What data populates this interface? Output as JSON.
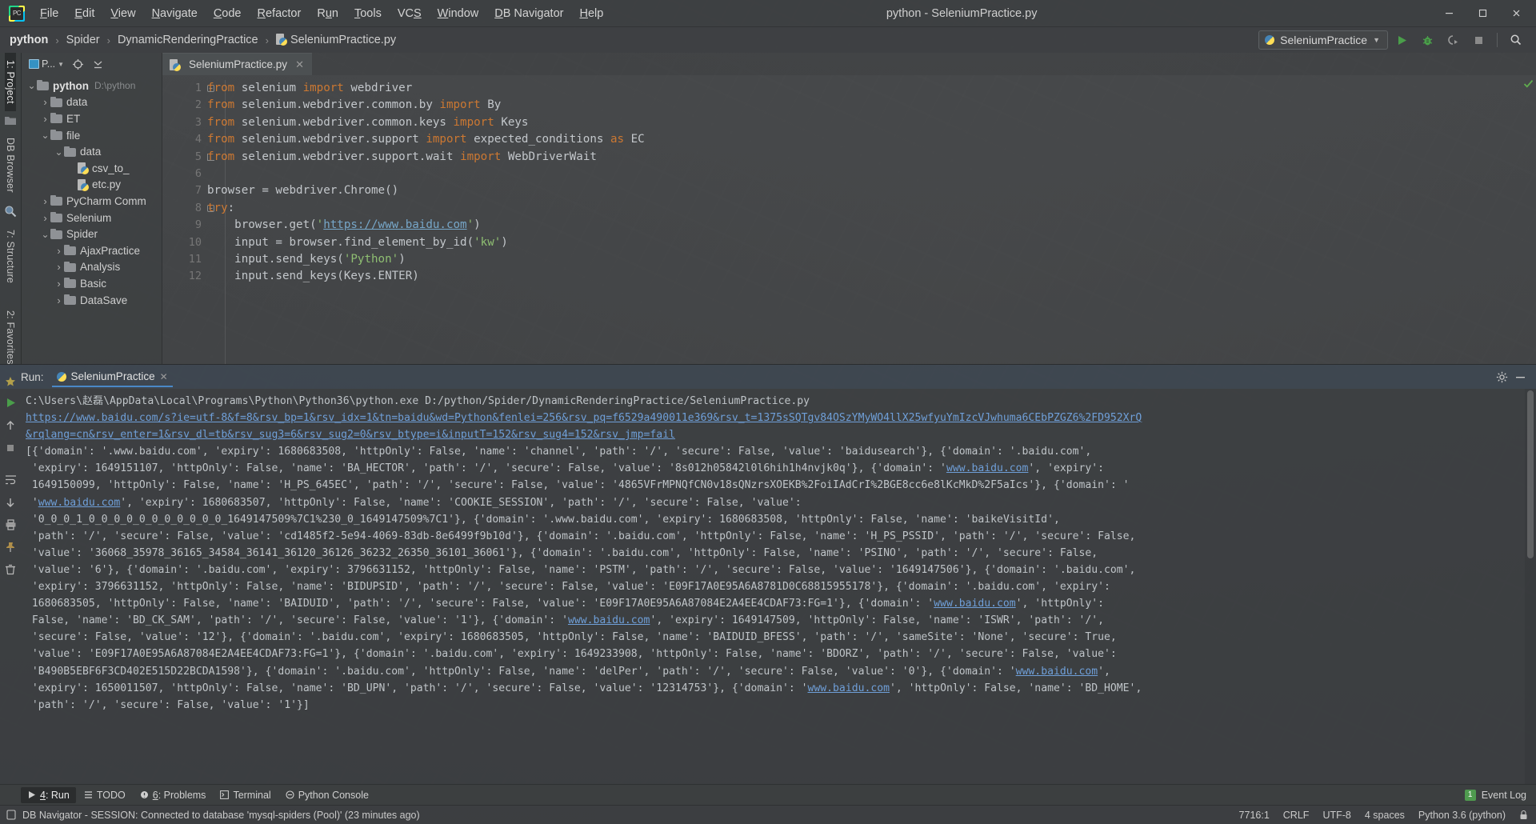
{
  "window": {
    "title": "python - SeleniumPractice.py",
    "logo_icon": "pycharm-logo-icon",
    "minimize_icon": "minimize-icon",
    "maximize_icon": "maximize-icon",
    "close_icon": "close-icon"
  },
  "menubar": {
    "items": [
      {
        "label": "File",
        "mnemonic": "F"
      },
      {
        "label": "Edit",
        "mnemonic": "E"
      },
      {
        "label": "View",
        "mnemonic": "V"
      },
      {
        "label": "Navigate",
        "mnemonic": "N"
      },
      {
        "label": "Code",
        "mnemonic": "C"
      },
      {
        "label": "Refactor",
        "mnemonic": "R"
      },
      {
        "label": "Run",
        "mnemonic": "u"
      },
      {
        "label": "Tools",
        "mnemonic": "T"
      },
      {
        "label": "VCS",
        "mnemonic": "S"
      },
      {
        "label": "Window",
        "mnemonic": "W"
      },
      {
        "label": "DB Navigator",
        "mnemonic": "D"
      },
      {
        "label": "Help",
        "mnemonic": "H"
      }
    ]
  },
  "breadcrumb": {
    "items": [
      "python",
      "Spider",
      "DynamicRenderingPractice",
      "SeleniumPractice.py"
    ],
    "separator": "›"
  },
  "toolbar": {
    "run_config": "SeleniumPractice",
    "run_icon": "run-play-icon",
    "debug_icon": "debug-bug-icon",
    "coverage_icon": "run-with-coverage-icon",
    "stop_icon": "stop-square-icon",
    "search_icon": "magnifier-search-icon"
  },
  "left_rail": {
    "project_label": "1: Project",
    "project_mnemonic": "1",
    "db_browser_label": "DB Browser",
    "structure_label": "7: Structure",
    "structure_mnemonic": "7",
    "favorites_label": "2: Favorites",
    "favorites_mnemonic": "2"
  },
  "project_panel": {
    "selector_label": "P...",
    "selector_icon": "project-view-icon",
    "locate_icon": "scroll-from-source-icon",
    "collapse_icon": "collapse-all-icon",
    "tree": [
      {
        "label": "python",
        "path": "D:\\python",
        "depth": 0,
        "arrow": "down",
        "bold": true
      },
      {
        "label": "data",
        "depth": 1,
        "arrow": "right"
      },
      {
        "label": "ET",
        "depth": 1,
        "arrow": "right"
      },
      {
        "label": "file",
        "depth": 1,
        "arrow": "down"
      },
      {
        "label": "data",
        "depth": 2,
        "arrow": "down"
      },
      {
        "label": "csv_to_",
        "depth": 3,
        "arrow": "none",
        "file": true
      },
      {
        "label": "etc.py",
        "depth": 3,
        "arrow": "none",
        "file": true
      },
      {
        "label": "PyCharm Comm",
        "depth": 1,
        "arrow": "right"
      },
      {
        "label": "Selenium",
        "depth": 1,
        "arrow": "right"
      },
      {
        "label": "Spider",
        "depth": 1,
        "arrow": "down"
      },
      {
        "label": "AjaxPractice",
        "depth": 2,
        "arrow": "right"
      },
      {
        "label": "Analysis",
        "depth": 2,
        "arrow": "right"
      },
      {
        "label": "Basic",
        "depth": 2,
        "arrow": "right"
      },
      {
        "label": "DataSave",
        "depth": 2,
        "arrow": "right"
      }
    ]
  },
  "editor": {
    "tab_label": "SeleniumPractice.py",
    "tab_icon": "python-file-icon",
    "tab_close_icon": "close-tab-icon",
    "inspection_icon": "inspection-ok-check-icon",
    "lines": [
      {
        "n": 1,
        "fold": "minus",
        "tokens": [
          {
            "t": "from ",
            "c": "kw"
          },
          {
            "t": "selenium ",
            "c": "pln"
          },
          {
            "t": "import ",
            "c": "kw"
          },
          {
            "t": "webdriver",
            "c": "pln"
          }
        ]
      },
      {
        "n": 2,
        "fold": "",
        "tokens": [
          {
            "t": "from ",
            "c": "kw"
          },
          {
            "t": "selenium.webdriver.common.by ",
            "c": "pln"
          },
          {
            "t": "import ",
            "c": "kw"
          },
          {
            "t": "By",
            "c": "pln"
          }
        ]
      },
      {
        "n": 3,
        "fold": "",
        "tokens": [
          {
            "t": "from ",
            "c": "kw"
          },
          {
            "t": "selenium.webdriver.common.keys ",
            "c": "pln"
          },
          {
            "t": "import ",
            "c": "kw"
          },
          {
            "t": "Keys",
            "c": "pln"
          }
        ]
      },
      {
        "n": 4,
        "fold": "",
        "tokens": [
          {
            "t": "from ",
            "c": "kw"
          },
          {
            "t": "selenium.webdriver.support ",
            "c": "pln"
          },
          {
            "t": "import ",
            "c": "kw"
          },
          {
            "t": "expected_conditions ",
            "c": "pln"
          },
          {
            "t": "as ",
            "c": "kw"
          },
          {
            "t": "EC",
            "c": "pln"
          }
        ]
      },
      {
        "n": 5,
        "fold": "end",
        "tokens": [
          {
            "t": "from ",
            "c": "kw"
          },
          {
            "t": "selenium.webdriver.support.wait ",
            "c": "pln"
          },
          {
            "t": "import ",
            "c": "kw"
          },
          {
            "t": "WebDriverWait",
            "c": "pln"
          }
        ]
      },
      {
        "n": 6,
        "fold": "",
        "tokens": [
          {
            "t": "",
            "c": "pln"
          }
        ]
      },
      {
        "n": 7,
        "fold": "",
        "tokens": [
          {
            "t": "browser = webdriver.Chrome()",
            "c": "pln"
          }
        ]
      },
      {
        "n": 8,
        "fold": "minus",
        "tokens": [
          {
            "t": "try",
            "c": "kw"
          },
          {
            "t": ":",
            "c": "pln"
          }
        ]
      },
      {
        "n": 9,
        "fold": "",
        "tokens": [
          {
            "t": "    browser.get(",
            "c": "pln"
          },
          {
            "t": "'",
            "c": "str"
          },
          {
            "t": "https://www.baidu.com",
            "c": "lnk"
          },
          {
            "t": "'",
            "c": "str"
          },
          {
            "t": ")",
            "c": "pln"
          }
        ]
      },
      {
        "n": 10,
        "fold": "",
        "tokens": [
          {
            "t": "    input = browser.find_element_by_id(",
            "c": "pln"
          },
          {
            "t": "'kw'",
            "c": "str"
          },
          {
            "t": ")",
            "c": "pln"
          }
        ]
      },
      {
        "n": 11,
        "fold": "",
        "tokens": [
          {
            "t": "    input.send_keys(",
            "c": "pln"
          },
          {
            "t": "'Python'",
            "c": "str"
          },
          {
            "t": ")",
            "c": "pln"
          }
        ]
      },
      {
        "n": 12,
        "fold": "",
        "tokens": [
          {
            "t": "    input.send_keys(Keys.ENTER)",
            "c": "pln"
          }
        ]
      }
    ]
  },
  "run_panel": {
    "label": "Run:",
    "tab_label": "SeleniumPractice",
    "tab_icon": "python-run-config-icon",
    "tab_close_icon": "close-run-tab-icon",
    "settings_icon": "gear-settings-icon",
    "hide_icon": "hide-panel-icon",
    "rerun_icon": "rerun-play-icon",
    "up_icon": "scroll-up-icon",
    "stop_icon": "stop-square-icon",
    "down_icon": "scroll-down-icon",
    "toggle_icon": "soft-wrap-icon",
    "print_icon": "print-icon",
    "pin_icon": "pin-tab-icon",
    "trash_icon": "clear-all-trash-icon",
    "console_lines": [
      {
        "segments": [
          {
            "t": "C:\\Users\\赵磊\\AppData\\Local\\Programs\\Python\\Python36\\python.exe D:/python/Spider/DynamicRenderingPractice/SeleniumPractice.py",
            "link": false
          }
        ]
      },
      {
        "segments": [
          {
            "t": "https://www.baidu.com/s?ie=utf-8&f=8&rsv_bp=1&rsv_idx=1&tn=baidu&wd=Python&fenlei=256&rsv_pq=f6529a490011e369&rsv_t=1375sSQTgv84OSzYMyWO4llX25wfyuYmIzcVJwhuma6CEbPZGZ6%2FD952XrQ",
            "link": true
          }
        ]
      },
      {
        "segments": [
          {
            "t": "&rqlang=cn&rsv_enter=1&rsv_dl=tb&rsv_sug3=6&rsv_sug2=0&rsv_btype=i&inputT=152&rsv_sug4=152&rsv_jmp=fail",
            "link": true
          }
        ]
      },
      {
        "segments": [
          {
            "t": "[{'domain': '.www.baidu.com', 'expiry': 1680683508, 'httpOnly': False, 'name': 'channel', 'path': '/', 'secure': False, 'value': 'baidusearch'}, {'domain': '.baidu.com',",
            "link": false
          }
        ]
      },
      {
        "segments": [
          {
            "t": " 'expiry': 1649151107, 'httpOnly': False, 'name': 'BA_HECTOR', 'path': '/', 'secure': False, 'value': '8s012h05842l0l6hih1h4nvjk0q'}, {'domain': '",
            "link": false
          },
          {
            "t": "www.baidu.com",
            "link": true
          },
          {
            "t": "', 'expiry':",
            "link": false
          }
        ]
      },
      {
        "segments": [
          {
            "t": " 1649150099, 'httpOnly': False, 'name': 'H_PS_645EC', 'path': '/', 'secure': False, 'value': '4865VFrMPNQfCN0v18sQNzrsXOEKB%2FoiIAdCrI%2BGE8cc6e8lKcMkD%2F5aIcs'}, {'domain': '",
            "link": false
          }
        ]
      },
      {
        "segments": [
          {
            "t": " '",
            "link": false
          },
          {
            "t": "www.baidu.com",
            "link": true
          },
          {
            "t": "', 'expiry': 1680683507, 'httpOnly': False, 'name': 'COOKIE_SESSION', 'path': '/', 'secure': False, 'value':",
            "link": false
          }
        ]
      },
      {
        "segments": [
          {
            "t": " '0_0_0_1_0_0_0_0_0_0_0_0_0_0_0_1649147509%7C1%230_0_1649147509%7C1'}, {'domain': '.www.baidu.com', 'expiry': 1680683508, 'httpOnly': False, 'name': 'baikeVisitId',",
            "link": false
          }
        ]
      },
      {
        "segments": [
          {
            "t": " 'path': '/', 'secure': False, 'value': 'cd1485f2-5e94-4069-83db-8e6499f9b10d'}, {'domain': '.baidu.com', 'httpOnly': False, 'name': 'H_PS_PSSID', 'path': '/', 'secure': False,",
            "link": false
          }
        ]
      },
      {
        "segments": [
          {
            "t": " 'value': '36068_35978_36165_34584_36141_36120_36126_36232_26350_36101_36061'}, {'domain': '.baidu.com', 'httpOnly': False, 'name': 'PSINO', 'path': '/', 'secure': False,",
            "link": false
          }
        ]
      },
      {
        "segments": [
          {
            "t": " 'value': '6'}, {'domain': '.baidu.com', 'expiry': 3796631152, 'httpOnly': False, 'name': 'PSTM', 'path': '/', 'secure': False, 'value': '1649147506'}, {'domain': '.baidu.com',",
            "link": false
          }
        ]
      },
      {
        "segments": [
          {
            "t": " 'expiry': 3796631152, 'httpOnly': False, 'name': 'BIDUPSID', 'path': '/', 'secure': False, 'value': 'E09F17A0E95A6A8781D0C68815955178'}, {'domain': '.baidu.com', 'expiry':",
            "link": false
          }
        ]
      },
      {
        "segments": [
          {
            "t": " 1680683505, 'httpOnly': False, 'name': 'BAIDUID', 'path': '/', 'secure': False, 'value': 'E09F17A0E95A6A87084E2A4EE4CDAF73:FG=1'}, {'domain': '",
            "link": false
          },
          {
            "t": "www.baidu.com",
            "link": true
          },
          {
            "t": "', 'httpOnly':",
            "link": false
          }
        ]
      },
      {
        "segments": [
          {
            "t": " False, 'name': 'BD_CK_SAM', 'path': '/', 'secure': False, 'value': '1'}, {'domain': '",
            "link": false
          },
          {
            "t": "www.baidu.com",
            "link": true
          },
          {
            "t": "', 'expiry': 1649147509, 'httpOnly': False, 'name': 'ISWR', 'path': '/',",
            "link": false
          }
        ]
      },
      {
        "segments": [
          {
            "t": " 'secure': False, 'value': '12'}, {'domain': '.baidu.com', 'expiry': 1680683505, 'httpOnly': False, 'name': 'BAIDUID_BFESS', 'path': '/', 'sameSite': 'None', 'secure': True,",
            "link": false
          }
        ]
      },
      {
        "segments": [
          {
            "t": " 'value': 'E09F17A0E95A6A87084E2A4EE4CDAF73:FG=1'}, {'domain': '.baidu.com', 'expiry': 1649233908, 'httpOnly': False, 'name': 'BDORZ', 'path': '/', 'secure': False, 'value':",
            "link": false
          }
        ]
      },
      {
        "segments": [
          {
            "t": " 'B490B5EBF6F3CD402E515D22BCDA1598'}, {'domain': '.baidu.com', 'httpOnly': False, 'name': 'delPer', 'path': '/', 'secure': False, 'value': '0'}, {'domain': '",
            "link": false
          },
          {
            "t": "www.baidu.com",
            "link": true
          },
          {
            "t": "',",
            "link": false
          }
        ]
      },
      {
        "segments": [
          {
            "t": " 'expiry': 1650011507, 'httpOnly': False, 'name': 'BD_UPN', 'path': '/', 'secure': False, 'value': '12314753'}, {'domain': '",
            "link": false
          },
          {
            "t": "www.baidu.com",
            "link": true
          },
          {
            "t": "', 'httpOnly': False, 'name': 'BD_HOME',",
            "link": false
          }
        ]
      },
      {
        "segments": [
          {
            "t": " 'path': '/', 'secure': False, 'value': '1'}]",
            "link": false
          }
        ]
      }
    ]
  },
  "tool_windows": {
    "items": [
      {
        "label": "4: Run",
        "mnemonic": "4",
        "icon": "run-play-icon",
        "active": true
      },
      {
        "label": "TODO",
        "icon": "todo-list-icon",
        "active": false
      },
      {
        "label": "6: Problems",
        "mnemonic": "6",
        "icon": "problems-warning-icon",
        "active": false
      },
      {
        "label": "Terminal",
        "icon": "terminal-icon",
        "active": false
      },
      {
        "label": "Python Console",
        "icon": "python-console-icon",
        "active": false
      }
    ],
    "event_log_label": "Event Log",
    "event_log_count": "1"
  },
  "statusbar": {
    "db_icon": "db-navigator-icon",
    "message": "DB Navigator - SESSION: Connected to database 'mysql-spiders (Pool)' (23 minutes ago)",
    "caret": "7716:1",
    "line_sep": "CRLF",
    "encoding": "UTF-8",
    "indent": "4 spaces",
    "interpreter": "Python 3.6 (python)",
    "lock_icon": "lock-icon"
  }
}
